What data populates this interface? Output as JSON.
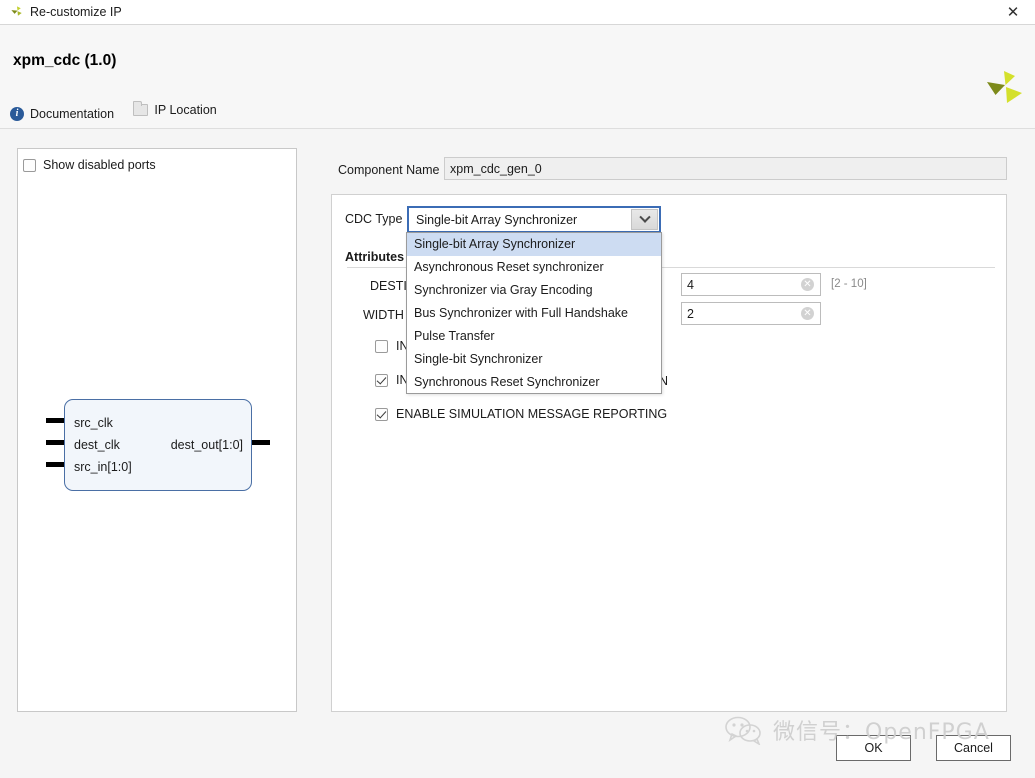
{
  "window": {
    "title": "Re-customize IP",
    "close_label": "✕",
    "app_icon": "vivado-logo-icon"
  },
  "header": {
    "ip_title": "xpm_cdc (1.0)",
    "links": [
      {
        "label": "Documentation",
        "icon": "info-icon"
      },
      {
        "label": "IP Location",
        "icon": "folder-icon"
      }
    ],
    "logo": "xilinx-logo-icon"
  },
  "diagram": {
    "show_disabled_ports_label": "Show disabled ports",
    "show_disabled_ports_checked": false,
    "inputs": [
      "src_clk",
      "dest_clk",
      "src_in[1:0]"
    ],
    "outputs": [
      "dest_out[1:0]"
    ]
  },
  "component": {
    "label": "Component Name",
    "value": "xpm_cdc_gen_0",
    "placeholder": "xpm_cdc_gen_0"
  },
  "options": {
    "cdc_type_label": "CDC Type",
    "cdc_type_value": "Single-bit Array Synchronizer",
    "attributes_label": "Attributes",
    "fields": [
      {
        "label": "DESTINATION SYNC FF",
        "label_visible": "DESTI",
        "value": "4",
        "range": "[2 - 10]",
        "clear_icon": "clear-circle-icon"
      },
      {
        "label": "WIDTH",
        "label_visible": "WIDTH",
        "value": "2",
        "range": "",
        "clear_icon": "clear-circle-icon"
      }
    ],
    "checkboxes": [
      {
        "label": "INIT SYNC FF",
        "label_visible": "INI",
        "checked": false
      },
      {
        "label": "INIT SYNC FF REGISTERED INPUT",
        "label_visible": "INI",
        "tail_visible": "N",
        "checked": true
      },
      {
        "label": "ENABLE SIMULATION MESSAGE REPORTING",
        "label_visible": "ENABLE SIMULATION MESSAGE REPORTING",
        "checked": true
      }
    ]
  },
  "dropdown": {
    "open": true,
    "selected_index": 0,
    "items": [
      "Single-bit Array Synchronizer",
      "Asynchronous Reset synchronizer",
      "Synchronizer via Gray Encoding",
      "Bus Synchronizer with Full Handshake",
      "Pulse Transfer",
      "Single-bit Synchronizer",
      "Synchronous Reset Synchronizer"
    ],
    "arrow_icon": "chevron-down-icon"
  },
  "footer": {
    "ok_label": "OK",
    "cancel_label": "Cancel"
  },
  "watermark": {
    "text": "微信号：OpenFPGA",
    "icon": "wechat-icon"
  },
  "colors": {
    "accent_blue": "#3b6cb5",
    "highlight": "#cddcf2",
    "logo_green": "#c3d12e",
    "logo_olive": "#7d8a1a",
    "info_blue": "#2a5a99"
  }
}
